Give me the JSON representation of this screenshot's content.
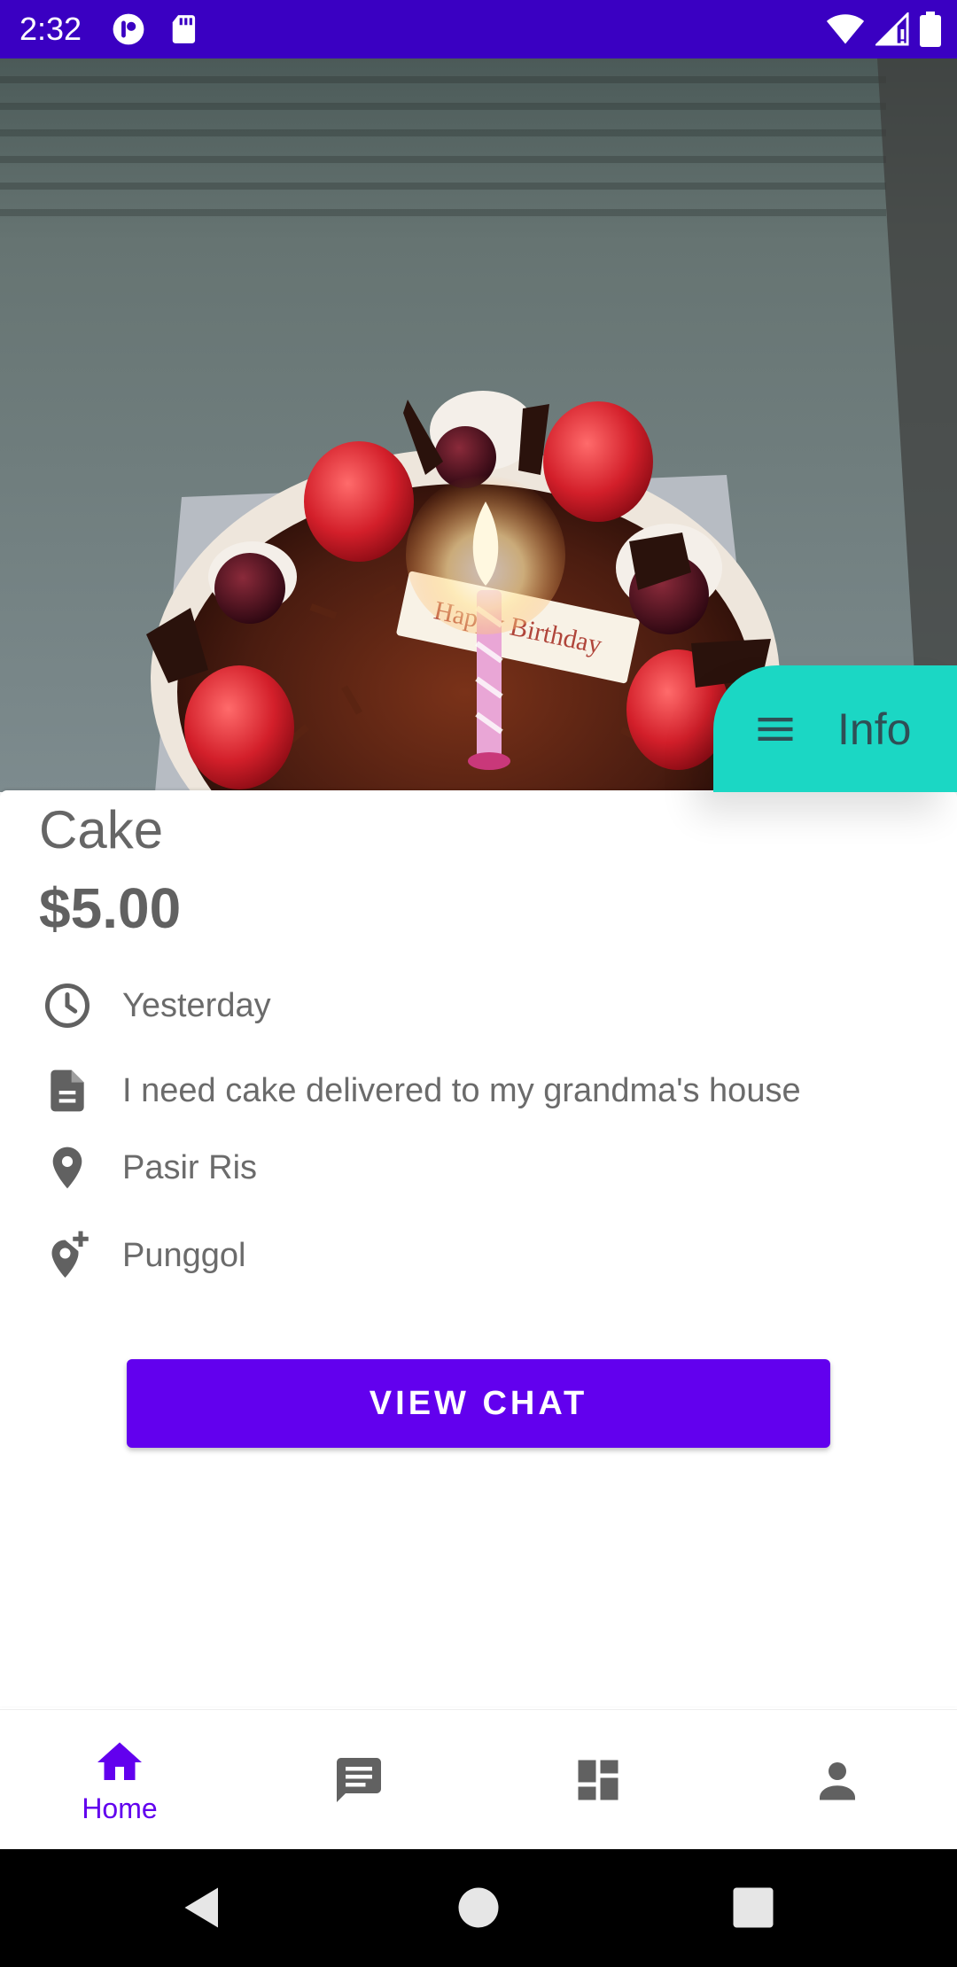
{
  "status_bar": {
    "time": "2:32",
    "color": "#3a00c2"
  },
  "hero": {
    "plate_text": "Happy Birthday"
  },
  "info_fab": {
    "label": "Info",
    "color": "#1bd7c4"
  },
  "item": {
    "title": "Cake",
    "price": "$5.00",
    "details": [
      {
        "icon": "clock-icon",
        "text": "Yesterday"
      },
      {
        "icon": "description-icon",
        "text": "I need cake delivered to my grandma's house"
      },
      {
        "icon": "location-pin-icon",
        "text": "Pasir Ris"
      },
      {
        "icon": "add-location-icon",
        "text": "Punggol"
      }
    ]
  },
  "actions": {
    "view_chat": "VIEW CHAT",
    "accent": "#6200ee"
  },
  "bottom_nav": {
    "items": [
      {
        "name": "home",
        "label": "Home",
        "active": true
      },
      {
        "name": "chat",
        "label": "",
        "active": false
      },
      {
        "name": "dashboard",
        "label": "",
        "active": false
      },
      {
        "name": "profile",
        "label": "",
        "active": false
      }
    ]
  }
}
